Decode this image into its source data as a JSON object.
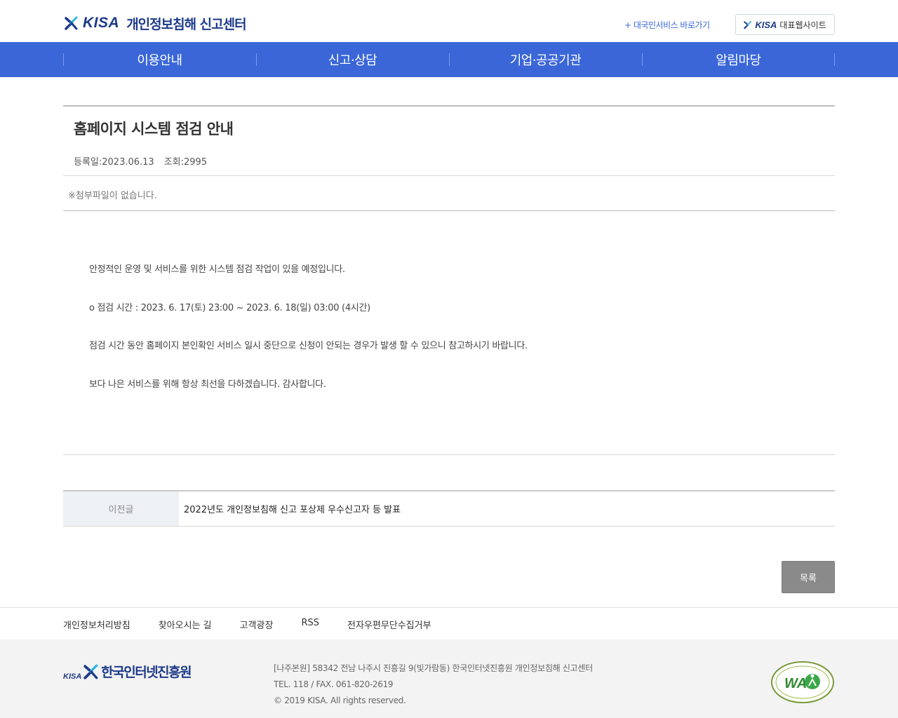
{
  "header": {
    "logo_brand": "KISA",
    "logo_title": "개인정보침해 신고센터",
    "minwon_link": "+ 대국민서비스 바로가기",
    "main_site_brand": "KISA",
    "main_site_label": "대표웹사이트"
  },
  "nav": {
    "items": [
      {
        "label": "이용안내"
      },
      {
        "label": "신고·상담"
      },
      {
        "label": "기업·공공기관"
      },
      {
        "label": "알림마당"
      }
    ]
  },
  "article": {
    "title": "홈페이지 시스템 점검 안내",
    "date_label": "등록일:2023.06.13",
    "views_label": "조회:2995",
    "attachment_notice": "※첨부파일이 없습니다.",
    "body": [
      "안정적인 운영 및 서비스를 위한 시스템 점검 작업이 있을 예정입니다.",
      "o 점검 시간 : 2023. 6. 17(토) 23:00 ~ 2023. 6. 18(일) 03:00 (4시간)",
      "점검 시간 동안 홈페이지 본인확인 서비스 일시 중단으로 신청이 안되는 경우가 발생 할 수 있으니 참고하시기 바랍니다.",
      "보다 나은 서비스를 위해 항상 최선을 다하겠습니다. 감사합니다."
    ]
  },
  "prev_post": {
    "label": "이전글",
    "title": "2022년도 개인정보침해 신고 포상제 우수신고자 등 발표"
  },
  "list_button": "목록",
  "footer": {
    "links": [
      "개인정보처리방침",
      "찾아오시는 길",
      "고객광장",
      "RSS",
      "전자우편무단수집거부"
    ],
    "logo_brand": "KISA",
    "logo_name": "한국인터넷진흥원",
    "address": "[나주본원] 58342 전남 나주시 진흥길 9(빛가람동) 한국인터넷진흥원 개인정보침해 신고센터",
    "tel": "TEL. 118 / FAX. 061-820-2619",
    "copyright": "© 2019 KISA. All rights reserved.",
    "wa_mark_text": "WA"
  },
  "colors": {
    "brand_blue": "#3a66d8",
    "logo_navy": "#1d3a8a",
    "button_gray": "#8a8a8a"
  }
}
